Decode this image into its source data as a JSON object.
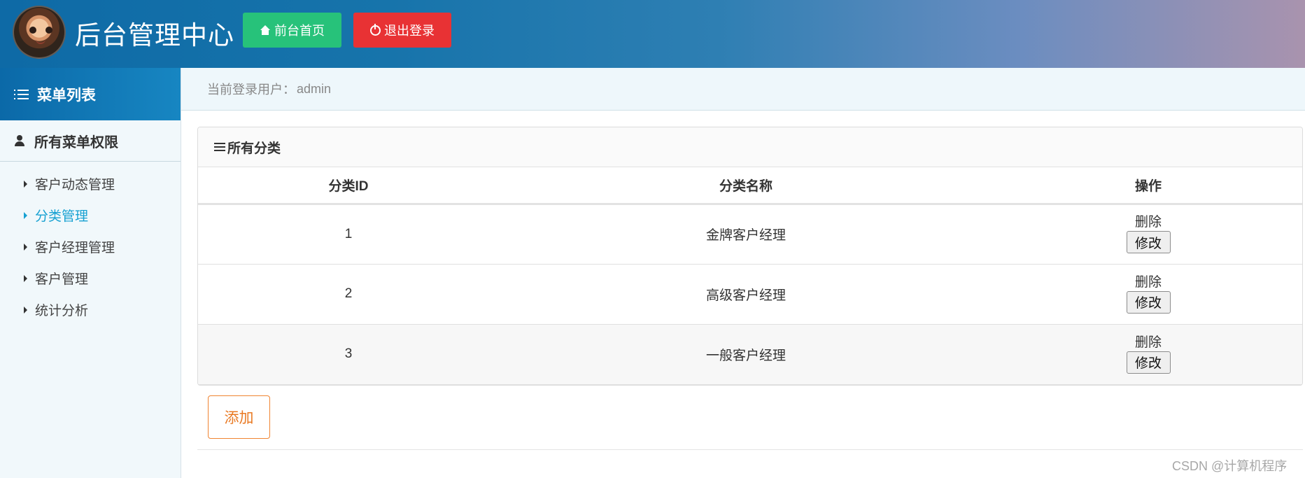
{
  "header": {
    "title": "后台管理中心",
    "home_label": "前台首页",
    "logout_label": "退出登录"
  },
  "sidebar": {
    "title": "菜单列表",
    "group_title": "所有菜单权限",
    "items": [
      {
        "label": "客户动态管理"
      },
      {
        "label": "分类管理"
      },
      {
        "label": "客户经理管理"
      },
      {
        "label": "客户管理"
      },
      {
        "label": "统计分析"
      }
    ]
  },
  "user_bar": {
    "prefix": "当前登录用户：",
    "username": "admin"
  },
  "panel": {
    "title": "所有分类",
    "columns": [
      "分类ID",
      "分类名称",
      "操作"
    ],
    "rows": [
      {
        "id": "1",
        "name": "金牌客户经理",
        "delete_label": "删除",
        "modify_label": "修改"
      },
      {
        "id": "2",
        "name": "高级客户经理",
        "delete_label": "删除",
        "modify_label": "修改"
      },
      {
        "id": "3",
        "name": "一般客户经理",
        "delete_label": "删除",
        "modify_label": "修改"
      }
    ],
    "add_label": "添加"
  },
  "watermark": "CSDN @计算机程序",
  "colors": {
    "header_blue": "#0e6aa6",
    "home_button": "#27c27a",
    "logout_button": "#e83234",
    "active_menu": "#17a1d2",
    "add_button": "#e97922"
  },
  "icons": {
    "home": "home-icon",
    "logout": "power-icon",
    "menu": "list-icon",
    "group": "user-icon",
    "panel": "hamburger-icon"
  }
}
